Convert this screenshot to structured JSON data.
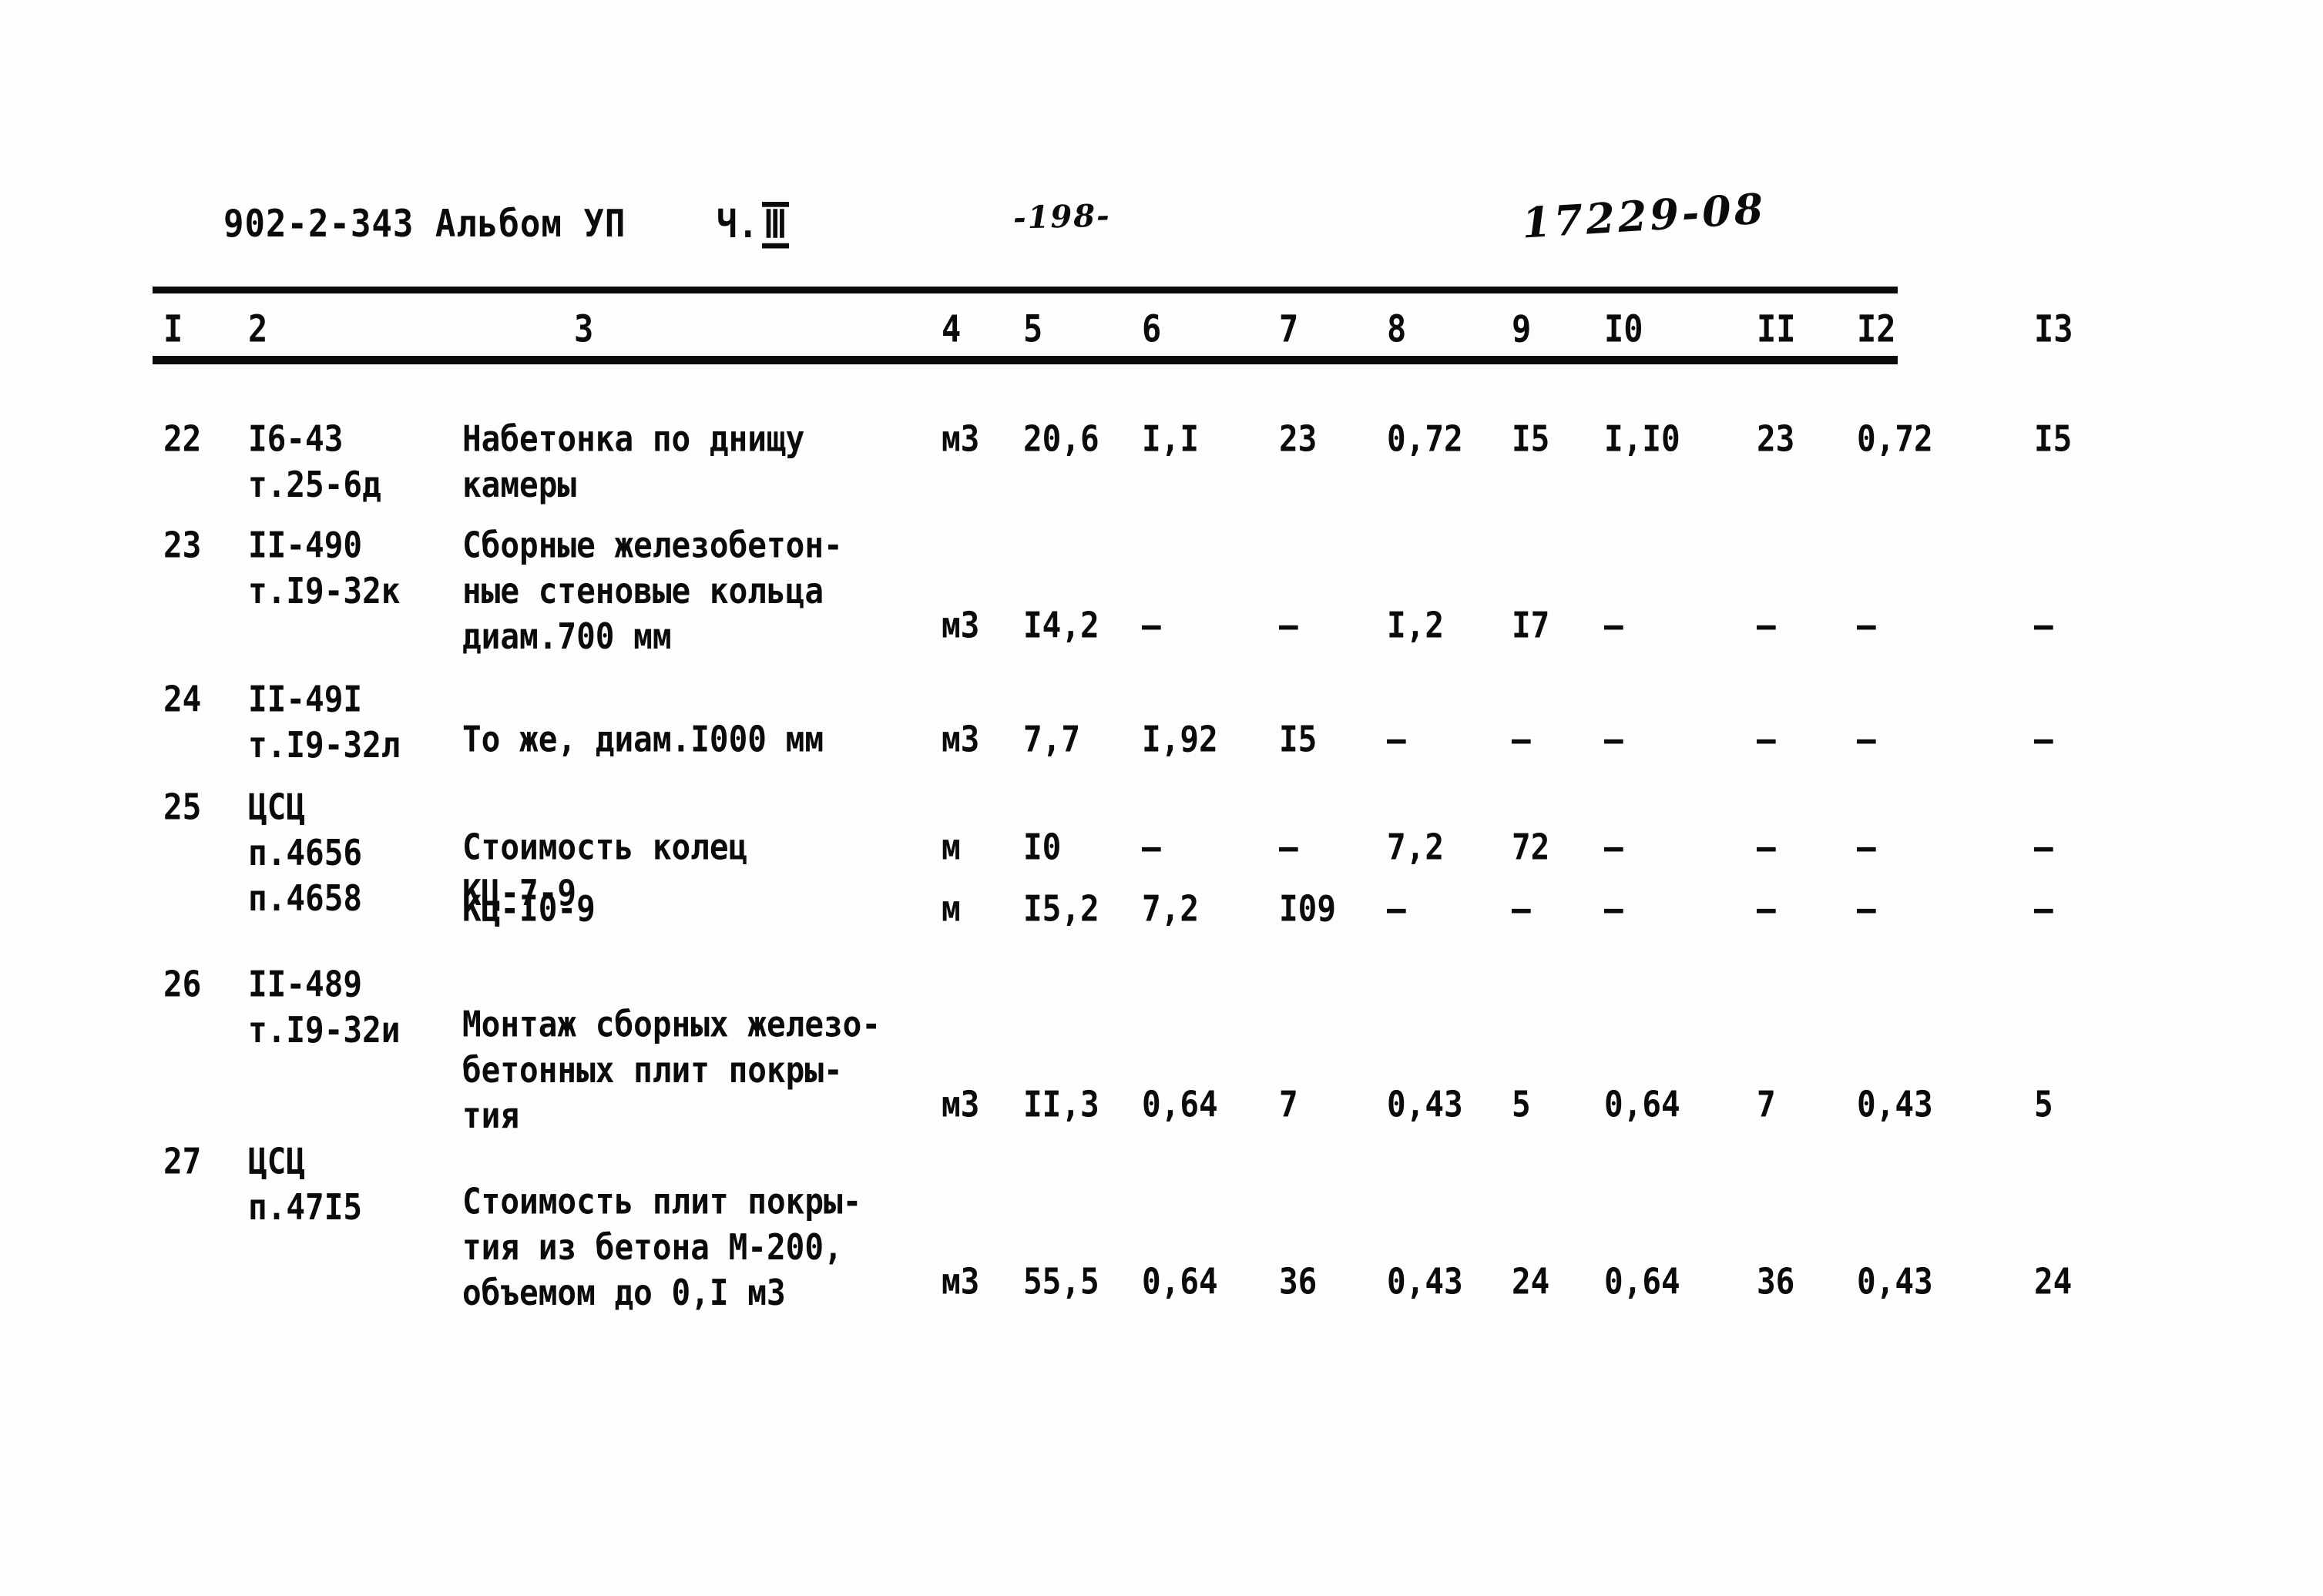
{
  "header": {
    "doc_code": "902-2-343  Альбом УП",
    "part_label": "Ч.",
    "part_numeral": "Ⅲ",
    "page_number": "-198-",
    "archive_number": "17229-08"
  },
  "table": {
    "column_headers": [
      "I",
      "2",
      "3",
      "4",
      "5",
      "6",
      "7",
      "8",
      "9",
      "I0",
      "II",
      "I2",
      "I3"
    ],
    "rows": [
      {
        "num": "22",
        "code": "I6-43\nт.25-6д",
        "description": "Набетонка по днищу\nкамеры",
        "unit": "м3",
        "c5": "20,6",
        "c6": "I,I",
        "c7": "23",
        "c8": "0,72",
        "c9": "I5",
        "c10": "I,I0",
        "c11": "23",
        "c12": "0,72",
        "c13": "I5"
      },
      {
        "num": "23",
        "code": "II-490\nт.I9-32к",
        "description": "Сборные железобетон-\nные стеновые кольца\nдиам.700 мм",
        "unit": "м3",
        "c5": "I4,2",
        "c6": "–",
        "c7": "–",
        "c8": "I,2",
        "c9": "I7",
        "c10": "–",
        "c11": "–",
        "c12": "–",
        "c13": "–"
      },
      {
        "num": "24",
        "code": "II-49I\nт.I9-32л",
        "description": "То же, диам.I000 мм",
        "unit": "м3",
        "c5": "7,7",
        "c6": "I,92",
        "c7": "I5",
        "c8": "–",
        "c9": "–",
        "c10": "–",
        "c11": "–",
        "c12": "–",
        "c13": "–"
      },
      {
        "num": "25",
        "code": "ЦСЦ\nп.4656\nп.4658",
        "description": "Стоимость колец\nКЦ-7-9",
        "unit": "м",
        "c5": "I0",
        "c6": "–",
        "c7": "–",
        "c8": "7,2",
        "c9": "72",
        "c10": "–",
        "c11": "–",
        "c12": "–",
        "c13": "–"
      },
      {
        "num": "",
        "code": "",
        "description": "КЦ-I0-9",
        "unit": "м",
        "c5": "I5,2",
        "c6": "7,2",
        "c7": "I09",
        "c8": "–",
        "c9": "–",
        "c10": "–",
        "c11": "–",
        "c12": "–",
        "c13": "–"
      },
      {
        "num": "26",
        "code": "II-489\nт.I9-32и",
        "description": "Монтаж сборных железо-\nбетонных плит покры-\nтия",
        "unit": "м3",
        "c5": "II,3",
        "c6": "0,64",
        "c7": "7",
        "c8": "0,43",
        "c9": "5",
        "c10": "0,64",
        "c11": "7",
        "c12": "0,43",
        "c13": "5"
      },
      {
        "num": "27",
        "code": "ЦСЦ\nп.47I5",
        "description": "Стоимость плит покры-\nтия из бетона М-200,\nобъемом до 0,I м3",
        "unit": "м3",
        "c5": "55,5",
        "c6": "0,64",
        "c7": "36",
        "c8": "0,43",
        "c9": "24",
        "c10": "0,64",
        "c11": "36",
        "c12": "0,43",
        "c13": "24"
      }
    ]
  }
}
